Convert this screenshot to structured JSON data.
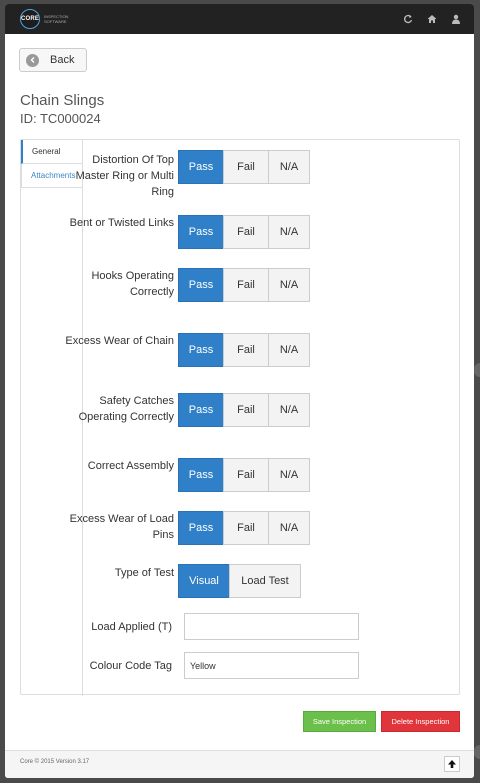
{
  "logo": {
    "text": "CORE",
    "sub": "INSPECTION SOFTWARE"
  },
  "header": {
    "icons": [
      "refresh-icon",
      "home-icon",
      "user-icon"
    ]
  },
  "back_label": "Back",
  "title": "Chain Slings",
  "id_label": "ID: TC000024",
  "tabs": [
    {
      "label": "General",
      "active": true
    },
    {
      "label": "Attachments",
      "active": false
    }
  ],
  "checks": [
    {
      "label": "Distortion Of Top Master Ring or Multi Ring",
      "selected": "Pass"
    },
    {
      "label": "Bent or Twisted Links",
      "selected": "Pass"
    },
    {
      "label": "Hooks Operating Correctly",
      "selected": "Pass"
    },
    {
      "label": "Excess Wear of Chain",
      "selected": "Pass"
    },
    {
      "label": "Safety Catches Operating Correctly",
      "selected": "Pass"
    },
    {
      "label": "Correct Assembly",
      "selected": "Pass"
    },
    {
      "label": "Excess Wear of Load Pins",
      "selected": "Pass"
    }
  ],
  "options": {
    "pass": "Pass",
    "fail": "Fail",
    "na": "N/A"
  },
  "test_type": {
    "label": "Type of Test",
    "visual": "Visual",
    "load": "Load Test",
    "selected": "Visual"
  },
  "load_applied": {
    "label": "Load Applied (T)",
    "value": ""
  },
  "colour_code": {
    "label": "Colour Code Tag",
    "value": "Yellow"
  },
  "save_label": "Save Inspection",
  "delete_label": "Delete Inspection",
  "footer_text": "Core © 2015 Version 3.17",
  "colors": {
    "primary": "#2f80c9",
    "save": "#6bc04b",
    "delete": "#e0353a"
  }
}
